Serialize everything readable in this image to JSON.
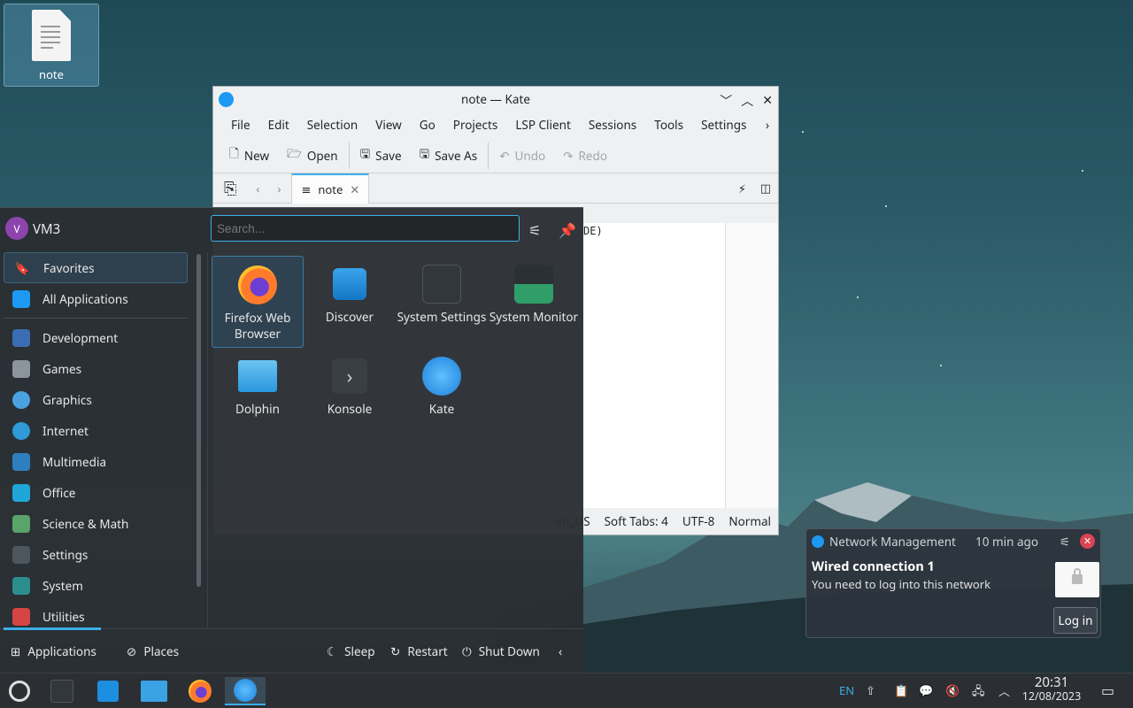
{
  "desktop": {
    "icon_label": "note"
  },
  "kate": {
    "title": "note — Kate",
    "menu": [
      "File",
      "Edit",
      "Selection",
      "View",
      "Go",
      "Projects",
      "LSP Client",
      "Sessions",
      "Tools",
      "Settings"
    ],
    "toolbar": {
      "new": "New",
      "open": "Open",
      "save": "Save",
      "save_as": "Save As",
      "undo": "Undo",
      "redo": "Redo"
    },
    "tab_label": "note",
    "editor_text_fragment": "DE)",
    "statusbar": {
      "language": "en_US",
      "tabs": "Soft Tabs: 4",
      "encoding": "UTF-8",
      "mode": "Normal"
    }
  },
  "launcher": {
    "user_name": "VM3",
    "avatar_letter": "V",
    "search_placeholder": "Search...",
    "categories": [
      {
        "label": "Favorites",
        "icon": "bookmark-icon"
      },
      {
        "label": "All Applications",
        "icon": "grid-icon"
      },
      {
        "label": "Development",
        "icon": "development-icon"
      },
      {
        "label": "Games",
        "icon": "gamepad-icon"
      },
      {
        "label": "Graphics",
        "icon": "graphics-icon"
      },
      {
        "label": "Internet",
        "icon": "globe-icon"
      },
      {
        "label": "Multimedia",
        "icon": "multimedia-icon"
      },
      {
        "label": "Office",
        "icon": "office-icon"
      },
      {
        "label": "Science & Math",
        "icon": "flask-icon"
      },
      {
        "label": "Settings",
        "icon": "settings-icon"
      },
      {
        "label": "System",
        "icon": "system-icon"
      },
      {
        "label": "Utilities",
        "icon": "toolbox-icon"
      }
    ],
    "favorites": [
      {
        "label": "Firefox Web Browser",
        "icon": "firefox-icon"
      },
      {
        "label": "Discover",
        "icon": "discover-icon"
      },
      {
        "label": "System Settings",
        "icon": "system-settings-icon"
      },
      {
        "label": "System Monitor",
        "icon": "system-monitor-icon"
      },
      {
        "label": "Dolphin",
        "icon": "dolphin-icon"
      },
      {
        "label": "Konsole",
        "icon": "konsole-icon"
      },
      {
        "label": "Kate",
        "icon": "kate-icon"
      }
    ],
    "footer": {
      "applications": "Applications",
      "places": "Places",
      "sleep": "Sleep",
      "restart": "Restart",
      "shutdown": "Shut Down"
    }
  },
  "notification": {
    "app_name": "Network Management",
    "time": "10 min ago",
    "title": "Wired connection 1",
    "body": "You need to log into this network",
    "action": "Log in"
  },
  "panel": {
    "language": "EN",
    "time": "20:31",
    "date": "12/08/2023"
  },
  "colors": {
    "accent": "#3daee9",
    "close_red": "#da4453",
    "panel_bg": "#2b2f33"
  }
}
